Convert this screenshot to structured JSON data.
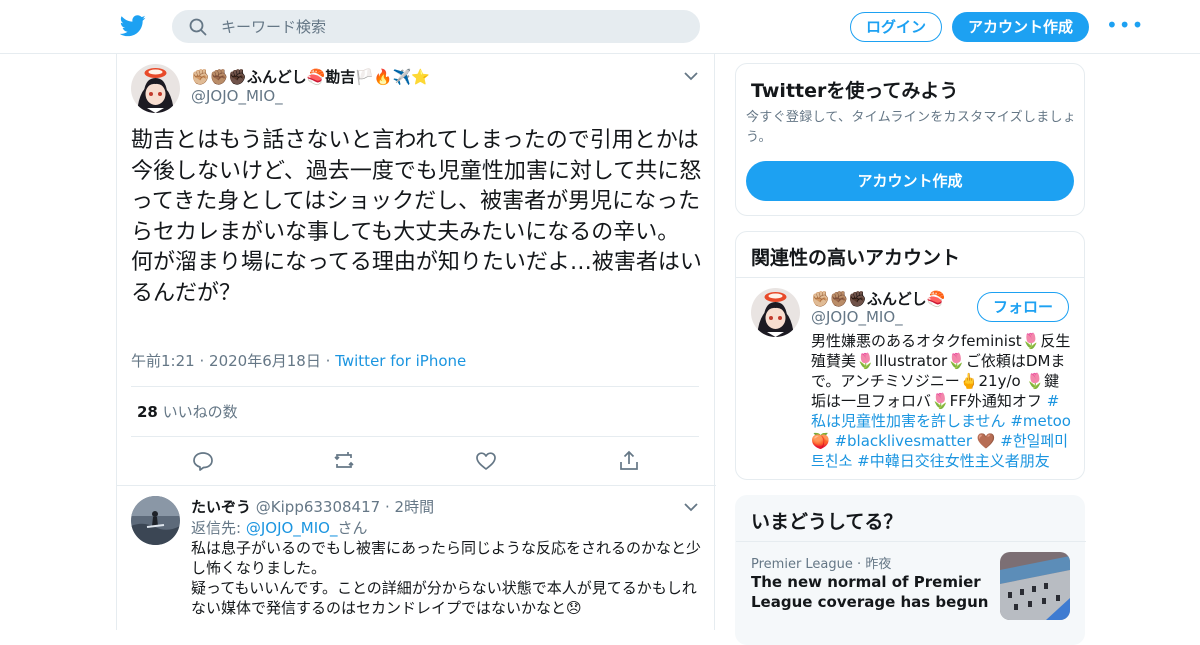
{
  "header": {
    "search_placeholder": "キーワード検索",
    "login_label": "ログイン",
    "signup_label": "アカウント作成",
    "more_label": "•••",
    "brand_color": "#1da1f2"
  },
  "tweet": {
    "display_name": "✊🏼✊🏽✊🏿ふんどし🍣勘吉🏳️🔥✈️⭐",
    "handle": "@JOJO_MIO_",
    "text": "勘吉とはもう話さないと言われてしまったので引用とかは今後しないけど、過去一度でも児童性加害に対して共に怒ってきた身としてはショックだし、被害者が男児になったらセカレまがいな事しても大丈夫みたいになるの辛い。\n何が溜まり場になってる理由が知りたいだよ…被害者はいるんだが？",
    "time": "午前1:21",
    "date": "2020年6月18日",
    "source": "Twitter for iPhone",
    "sep": "·",
    "like_count": "28",
    "like_label": "いいねの数"
  },
  "reply": {
    "display_name": "たいぞう",
    "handle": "@Kipp63308417",
    "sep": "·",
    "time": "2時間",
    "reply_to_label": "返信先:",
    "reply_to_handle": "@JOJO_MIO_",
    "reply_to_suffix": "さん",
    "text": "私は息子がいるのでもし被害にあったら同じような反応をされるのかなと少し怖くなりました。\n疑ってもいいんです。ことの詳細が分からない状態で本人が見てるかもしれない媒体で発信するのはセカンドレイプではないかなと😞"
  },
  "sidebar": {
    "signup_card": {
      "title": "Twitterを使ってみよう",
      "description": "今すぐ登録して、タイムラインをカスタマイズしましょう。",
      "button_label": "アカウント作成"
    },
    "related": {
      "title": "関連性の高いアカウント",
      "display_name": "✊🏼✊🏽✊🏿ふんどし🍣",
      "handle": "@JOJO_MIO_",
      "follow_label": "フォロー",
      "bio_text": "男性嫌悪のあるオタクfeminist🌷反生殖賛美🌷Illustrator🌷ご依頼はDMまで。アンチミソジニー🖕21y/o 🌷鍵垢は一旦フォロバ🌷FF外通知オフ ",
      "bio_tags": "#私は児童性加害を許しません #metoo 🍑 #blacklivesmatter 🤎 #한일페미트친소 #中韓日交往女性主义者朋友"
    },
    "trends": {
      "title": "いまどうしてる？",
      "category": "Premier League",
      "sep": "·",
      "time": "昨夜",
      "headline": "The new normal of Premier League coverage has begun"
    }
  }
}
